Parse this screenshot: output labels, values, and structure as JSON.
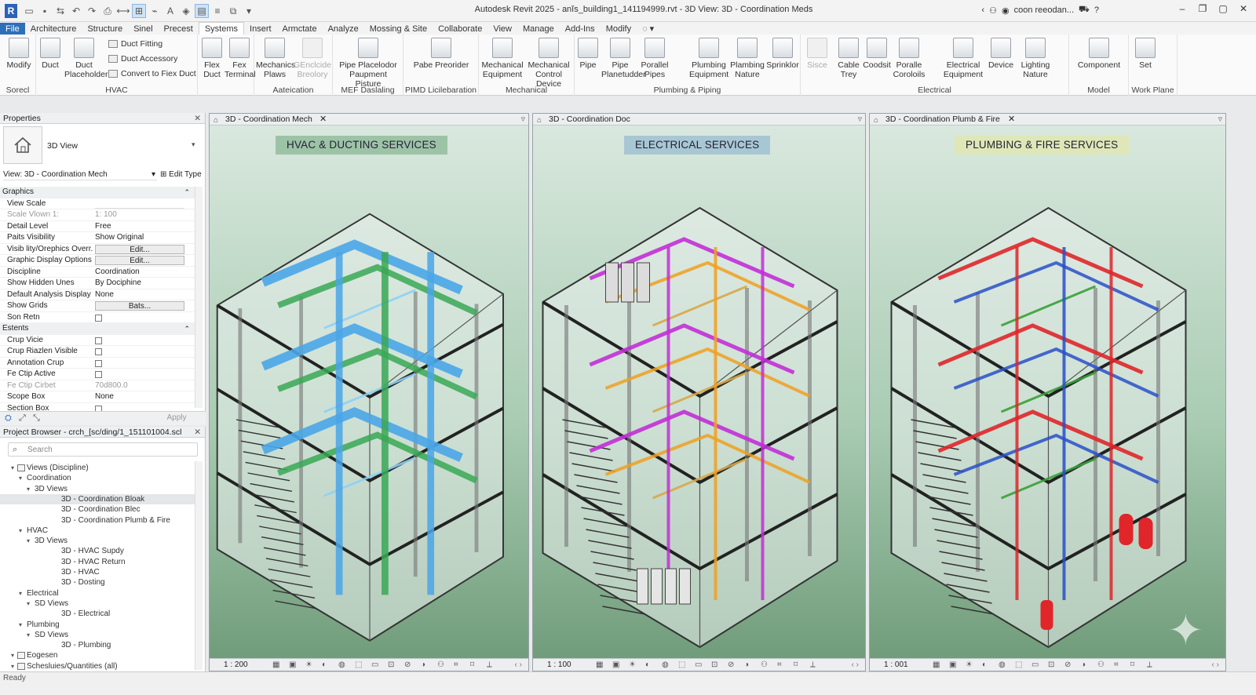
{
  "app": {
    "title": "Autodesk Revit 2025 - anĭs_building1_141194999.rvt - 3D View: 3D - Coordination Meds",
    "user": "coon reeodan...",
    "logo": "R"
  },
  "tabs": [
    "File",
    "Architecture",
    "Structure",
    "Sinel",
    "Precest",
    "Systems",
    "Insert",
    "Armctate",
    "Analyze",
    "Mossing & Site",
    "Collaborate",
    "View",
    "Manage",
    "Add-Ins",
    "Modify"
  ],
  "active_tab": "Systems",
  "ribbon": {
    "select": {
      "modify": "Modify",
      "panel": "Sorecl"
    },
    "hvac": {
      "duct": "Duct",
      "duct_placeholder": "Duct Placeholder",
      "duct_fitting": "Duct Fitting",
      "duct_accessory": "Duct Accessory",
      "convert": "Convert to Fiex Duct",
      "flex_duct": "Flex Duct",
      "fex_terminal": "Fex Terminal",
      "panel": "HVAC"
    },
    "fabrication": {
      "mechanics": "Mechanics Plaws",
      "glencide": "GEnclcide Breolory",
      "panel": "Aateication"
    },
    "mep_detailing": {
      "pipe_placeholder": "Pipe Placelodor Paupment Pisture",
      "panel": "MEF Daslaling"
    },
    "pimd": {
      "pabe": "Pabe Preorider",
      "panel": "PIMD Licilebaration"
    },
    "mechanical": {
      "equip": "Mechanical Equipment",
      "control": "Mechanical Control Device",
      "panel": "Mechanical"
    },
    "plumbing": {
      "pipe": "Pipe",
      "pipe_placeholder": "Pipe Planetudder",
      "parallel": "Porallel Pipes",
      "plumb_equip": "Plumbing Equipment",
      "plumb_nature": "Plambing Nature",
      "sprinkler": "Sprinklor",
      "panel": "Plumbing & Piping"
    },
    "electrical": {
      "sisce": "Sisce",
      "cable": "Cable Trey",
      "coodsit": "Coodsit",
      "parallel": "Poralle Coroloils",
      "elec_equip": "Electrical Equipment",
      "device": "Device",
      "lighting": "Lighting Nature",
      "panel": "Electrical"
    },
    "model": {
      "component": "Component",
      "panel": "Model"
    },
    "workplane": {
      "set": "Set",
      "panel": "Work Plane"
    }
  },
  "properties": {
    "title": "Properties",
    "type": "3D View",
    "view_selector": "View: 3D - Coordination Mech",
    "edit_type": "Edit Type",
    "rows": [
      {
        "k": "Graphics",
        "v": "",
        "kind": "sec"
      },
      {
        "k": "View Scale",
        "v": "",
        "kind": "input"
      },
      {
        "k": "Scale Vlown   1:",
        "v": "1: 100",
        "kind": "gray"
      },
      {
        "k": "Detail Level",
        "v": "Free",
        "kind": "text"
      },
      {
        "k": "Paits Visibility",
        "v": "Show Original",
        "kind": "text"
      },
      {
        "k": "Visib lity/Orephics Overr...",
        "v": "Edit...",
        "kind": "btn"
      },
      {
        "k": "Graphic Display Options",
        "v": "Edit...",
        "kind": "btn"
      },
      {
        "k": "Discipline",
        "v": "Coordination",
        "kind": "text"
      },
      {
        "k": "Show Hidden Unes",
        "v": "By Dociphine",
        "kind": "text"
      },
      {
        "k": "Default Analysis Display ...",
        "v": "None",
        "kind": "text"
      },
      {
        "k": "Show Grids",
        "v": "Bats...",
        "kind": "btn"
      },
      {
        "k": "Son Retn",
        "v": "",
        "kind": "cb"
      },
      {
        "k": "Estents",
        "v": "",
        "kind": "sec"
      },
      {
        "k": "Crup Vicie",
        "v": "",
        "kind": "cb"
      },
      {
        "k": "Crup Riazlen Visible",
        "v": "",
        "kind": "cb"
      },
      {
        "k": "Annotation Crup",
        "v": "",
        "kind": "cb"
      },
      {
        "k": "Fe Ctip Active",
        "v": "",
        "kind": "cb"
      },
      {
        "k": "Fe Ctip Cirbet",
        "v": "70d800.0",
        "kind": "gray"
      },
      {
        "k": "Scope Box",
        "v": "None",
        "kind": "text"
      },
      {
        "k": "Section Box",
        "v": "",
        "kind": "cb"
      }
    ],
    "apply": "Apply"
  },
  "browser": {
    "title": "Project Browser - crch_[sc/ding/1_151101004.scl",
    "search_placeholder": "Search",
    "items": [
      {
        "label": "Views (Discipline)",
        "level": 0,
        "icon": true
      },
      {
        "label": "Coordination",
        "level": 1
      },
      {
        "label": "3D Views",
        "level": 2
      },
      {
        "label": "3D - Coordination Bloak",
        "level": 3,
        "selected": true
      },
      {
        "label": "3D - Coordination Blec",
        "level": 3
      },
      {
        "label": "3D - Coordination Plumb & Fire",
        "level": 3
      },
      {
        "label": "HVAC",
        "level": 1
      },
      {
        "label": "3D Views",
        "level": 2
      },
      {
        "label": "3D - HVAC Supdy",
        "level": 3
      },
      {
        "label": "3D - HVAC Return",
        "level": 3
      },
      {
        "label": "3D - HVAC",
        "level": 3
      },
      {
        "label": "3D - Dosting",
        "level": 3
      },
      {
        "label": "Electrical",
        "level": 1
      },
      {
        "label": "SD Views",
        "level": 2
      },
      {
        "label": "3D - Electrical",
        "level": 3
      },
      {
        "label": "Plumbing",
        "level": 1
      },
      {
        "label": "SD Views",
        "level": 2
      },
      {
        "label": "3D - Plumbing",
        "level": 3
      },
      {
        "label": "Eogesen",
        "level": 0,
        "icon": true
      },
      {
        "label": "Schesluies/Quantities (all)",
        "level": 0,
        "icon": true
      }
    ]
  },
  "viewports": [
    {
      "tab": "3D - Coordination Mech",
      "label": "HVAC & DUCTING SERVICES",
      "scale": "1 : 200",
      "label_bg": "#9dc3a7",
      "closable": true
    },
    {
      "tab": "3D - Coordination Doc",
      "label": "ELECTRICAL SERVICES",
      "scale": "1 : 100",
      "label_bg": "#a8c7d4",
      "closable": false
    },
    {
      "tab": "3D - Coordination Plumb & Fire",
      "label": "PLUMBING & FIRE SERVICES",
      "scale": "1 : 001",
      "label_bg": "#dfe7b8",
      "closable": true
    }
  ],
  "status": {
    "text": "Ready"
  },
  "colors": {
    "accent": "#2d6fba",
    "hvac": "#4aa6e8",
    "hvac_green": "#3aa856",
    "electrical": "#c22fd6",
    "electrical_orange": "#f0a020",
    "plumbing_red": "#e0262a",
    "plumbing_blue": "#2950c8"
  }
}
